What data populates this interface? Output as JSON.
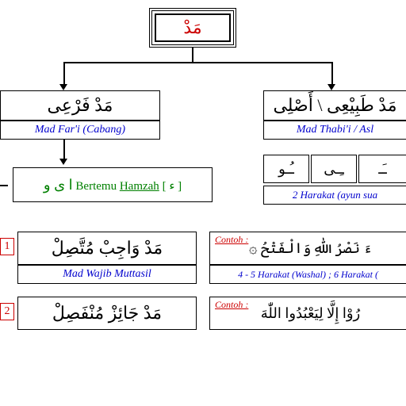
{
  "root": {
    "arabic": "مَدْ"
  },
  "left_branch": {
    "arabic": "مَدْ فَرْعِى",
    "latin": "Mad Far'i (Cabang)"
  },
  "right_branch": {
    "arabic": "مَدْ طَبِيْعِى \\ أَصْلِى",
    "latin": "Mad Thabi'i / Asl"
  },
  "hamzah": {
    "letters": "ا ى و",
    "text": "Bertemu ",
    "word": "Hamzah",
    "bracket": " [ ء ]"
  },
  "harakat": {
    "seg1": "ـُـو",
    "seg2": "ـِـى",
    "seg3": "ـَـ",
    "caption": "2 Harakat (ayun sua"
  },
  "item1": {
    "num": "1",
    "arabic": "مَدْ وَاجِبْ مُتَّصِلْ",
    "latin": "Mad Wajib Muttasil"
  },
  "item2": {
    "num": "2",
    "arabic": "مَدْ جَائِزْ مُنْفَصِلْ"
  },
  "contoh1": {
    "label": "Contoh :",
    "arabic": "ءَ نَصْرُ اللّٰهِ وَالْفَتْحُ ۞",
    "caption": "4 - 5 Harakat (Washal) ; 6 Harakat ("
  },
  "contoh2": {
    "label": "Contoh :",
    "arabic": "رُوْا  إِلَّا لِيَعْبُدُوا اللّٰهَ"
  }
}
